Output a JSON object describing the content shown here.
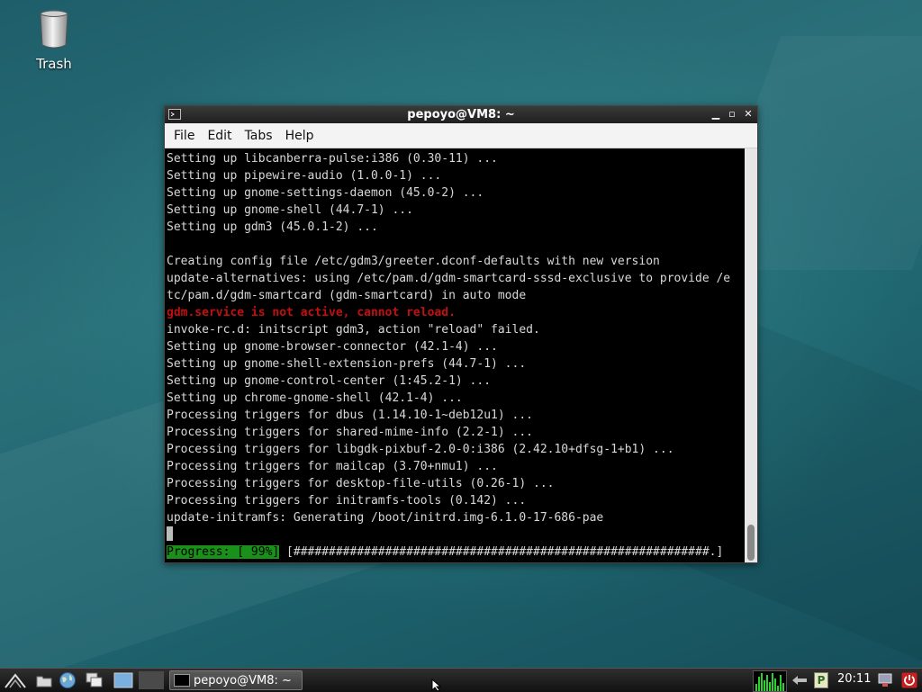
{
  "desktop": {
    "trash_label": "Trash"
  },
  "window": {
    "title": "pepoyo@VM8: ~",
    "menu": [
      "File",
      "Edit",
      "Tabs",
      "Help"
    ]
  },
  "terminal": {
    "lines_before": [
      "Setting up libcanberra-pulse:i386 (0.30-11) ...",
      "Setting up pipewire-audio (1.0.0-1) ...",
      "Setting up gnome-settings-daemon (45.0-2) ...",
      "Setting up gnome-shell (44.7-1) ...",
      "Setting up gdm3 (45.0.1-2) ...",
      "",
      "Creating config file /etc/gdm3/greeter.dconf-defaults with new version",
      "update-alternatives: using /etc/pam.d/gdm-smartcard-sssd-exclusive to provide /e",
      "tc/pam.d/gdm-smartcard (gdm-smartcard) in auto mode"
    ],
    "error_line": "gdm.service is not active, cannot reload.",
    "lines_after": [
      "invoke-rc.d: initscript gdm3, action \"reload\" failed.",
      "Setting up gnome-browser-connector (42.1-4) ...",
      "Setting up gnome-shell-extension-prefs (44.7-1) ...",
      "Setting up gnome-control-center (1:45.2-1) ...",
      "Setting up chrome-gnome-shell (42.1-4) ...",
      "Processing triggers for dbus (1.14.10-1~deb12u1) ...",
      "Processing triggers for shared-mime-info (2.2-1) ...",
      "Processing triggers for libgdk-pixbuf-2.0-0:i386 (2.42.10+dfsg-1+b1) ...",
      "Processing triggers for mailcap (3.70+nmu1) ...",
      "Processing triggers for desktop-file-utils (0.26-1) ...",
      "Processing triggers for initramfs-tools (0.142) ...",
      "update-initramfs: Generating /boot/initrd.img-6.1.0-17-686-pae"
    ],
    "progress_label": "Progress: [ 99%]",
    "progress_bar": " [###########################################################.]"
  },
  "taskbar": {
    "task_label": "pepoyo@VM8: ~",
    "clock": "20:11",
    "tray_p": "P"
  },
  "colors": {
    "error": "#c01010",
    "progress_bg": "#1a8f1a",
    "cpu_graph": "#2bd22b"
  }
}
